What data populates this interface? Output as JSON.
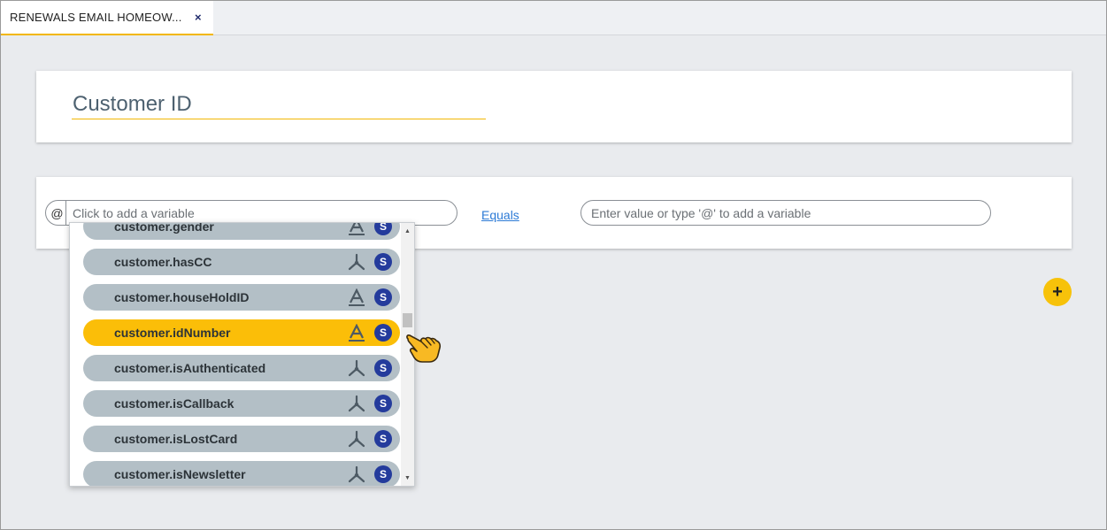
{
  "tab": {
    "title": "RENEWALS EMAIL HOMEOW...",
    "close": "×"
  },
  "name_field": {
    "value": "Customer ID"
  },
  "condition": {
    "at_sign": "@",
    "variable_placeholder": "Click to add a variable",
    "operator": "Equals",
    "value_placeholder": "Enter value or type '@' to add a variable"
  },
  "add_button": {
    "label": "+"
  },
  "dropdown": {
    "items": [
      {
        "label": "customer.gender",
        "type": "text-icon",
        "badge": "S"
      },
      {
        "label": "customer.hasCC",
        "type": "boolean-icon",
        "badge": "S"
      },
      {
        "label": "customer.houseHoldID",
        "type": "text-icon",
        "badge": "S"
      },
      {
        "label": "customer.idNumber",
        "type": "text-icon",
        "badge": "S",
        "selected": true
      },
      {
        "label": "customer.isAuthenticated",
        "type": "boolean-icon",
        "badge": "S"
      },
      {
        "label": "customer.isCallback",
        "type": "boolean-icon",
        "badge": "S"
      },
      {
        "label": "customer.isLostCard",
        "type": "boolean-icon",
        "badge": "S"
      },
      {
        "label": "customer.isNewsletter",
        "type": "boolean-icon",
        "badge": "S"
      }
    ],
    "scroll_up": "▲",
    "scroll_down": "▼"
  },
  "colors": {
    "accent": "#fbbe08",
    "item_bg": "#b3bfc6",
    "badge": "#243b9c",
    "link": "#2d7bd6"
  }
}
